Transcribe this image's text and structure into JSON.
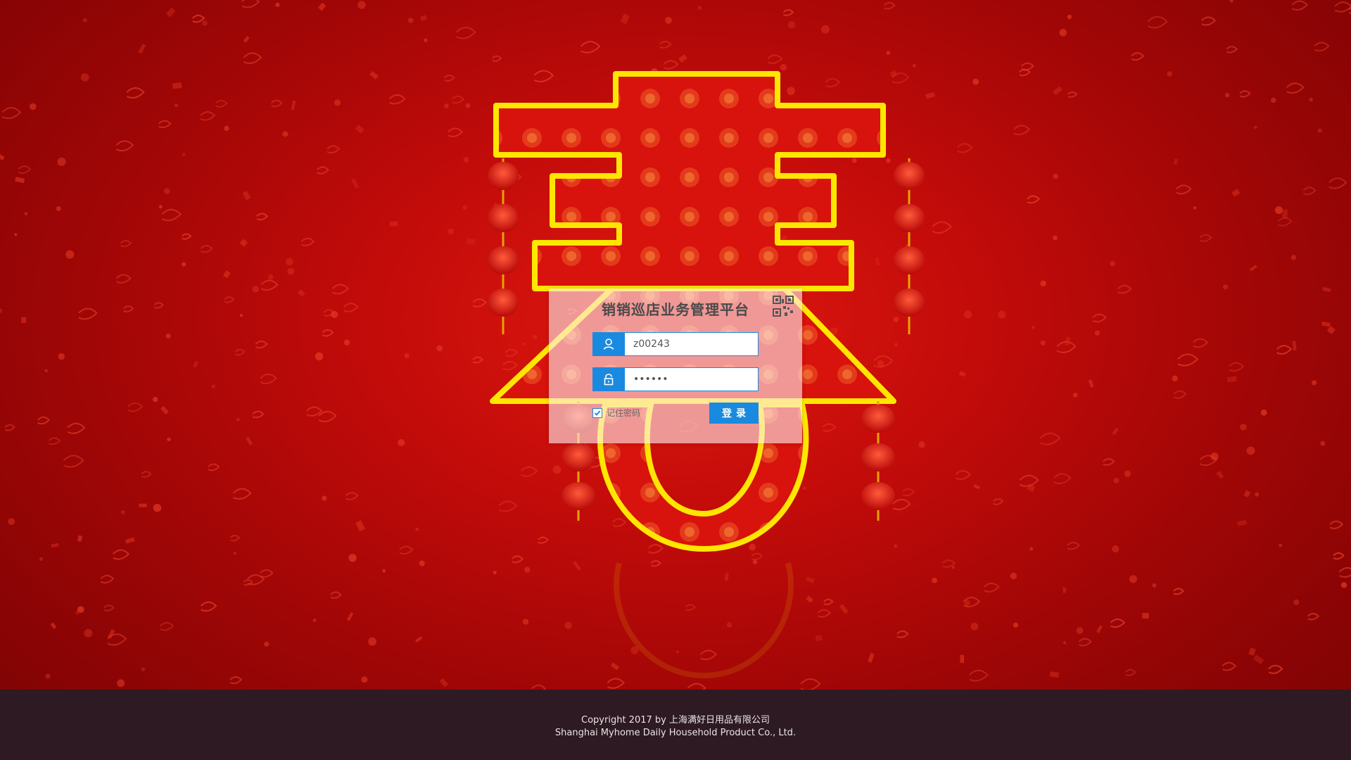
{
  "login": {
    "title": "销销巡店业务管理平台",
    "username_value": "z00243",
    "password_value": "••••••",
    "remember_label": "记住密码",
    "remember_checked": true,
    "submit_label": "登录",
    "accent_color": "#1a8ae0"
  },
  "icons": {
    "qr": "qr-code-icon",
    "user": "user-icon",
    "password": "lock-icon",
    "check": "check-icon"
  },
  "footer": {
    "copyright": "Copyright 2017 by 上海满好日用品有限公司",
    "company_en": "Shanghai Myhome Daily Household Product Co., Ltd."
  }
}
